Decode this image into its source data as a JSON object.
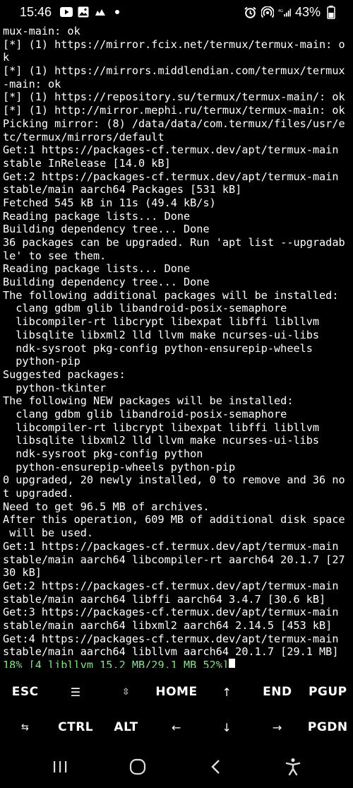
{
  "status_bar": {
    "time": "15:46",
    "battery": "43%",
    "left_icons": [
      "youtube-icon",
      "gallery-icon",
      "cloud-icon",
      "dot-icon"
    ],
    "right_icons": [
      "alarm-icon",
      "hotspot-icon",
      "signal-icon",
      "battery-icon"
    ]
  },
  "terminal": {
    "lines": [
      "mux-main: ok",
      "[*] (1) https://mirror.fcix.net/termux/termux-main: o",
      "k",
      "[*] (1) https://mirrors.middlendian.com/termux/termux",
      "-main: ok",
      "[*] (1) https://repository.su/termux/termux-main/: ok",
      "[*] (1) http://mirror.mephi.ru/termux/termux-main: ok",
      "Picking mirror: (8) /data/data/com.termux/files/usr/e",
      "tc/termux/mirrors/default",
      "Get:1 https://packages-cf.termux.dev/apt/termux-main",
      "stable InRelease [14.0 kB]",
      "Get:2 https://packages-cf.termux.dev/apt/termux-main",
      "stable/main aarch64 Packages [531 kB]",
      "Fetched 545 kB in 11s (49.4 kB/s)",
      "Reading package lists... Done",
      "Building dependency tree... Done",
      "36 packages can be upgraded. Run 'apt list --upgradab",
      "le' to see them.",
      "Reading package lists... Done",
      "Building dependency tree... Done",
      "The following additional packages will be installed:",
      "  clang gdbm glib libandroid-posix-semaphore",
      "  libcompiler-rt libcrypt libexpat libffi libllvm",
      "  libsqlite libxml2 lld llvm make ncurses-ui-libs",
      "  ndk-sysroot pkg-config python-ensurepip-wheels",
      "  python-pip",
      "Suggested packages:",
      "  python-tkinter",
      "The following NEW packages will be installed:",
      "  clang gdbm glib libandroid-posix-semaphore",
      "  libcompiler-rt libcrypt libexpat libffi libllvm",
      "  libsqlite libxml2 lld llvm make ncurses-ui-libs",
      "  ndk-sysroot pkg-config python",
      "  python-ensurepip-wheels python-pip",
      "0 upgraded, 20 newly installed, 0 to remove and 36 no",
      "t upgraded.",
      "Need to get 96.5 MB of archives.",
      "After this operation, 609 MB of additional disk space",
      " will be used.",
      "Get:1 https://packages-cf.termux.dev/apt/termux-main",
      "stable/main aarch64 libcompiler-rt aarch64 20.1.7 [27",
      "30 kB]",
      "Get:2 https://packages-cf.termux.dev/apt/termux-main",
      "stable/main aarch64 libffi aarch64 3.4.7 [30.6 kB]",
      "Get:3 https://packages-cf.termux.dev/apt/termux-main",
      "stable/main aarch64 libxml2 aarch64 2.14.5 [453 kB]",
      "Get:4 https://packages-cf.termux.dev/apt/termux-main",
      "stable/main aarch64 libllvm aarch64 20.1.7 [29.1 MB]"
    ],
    "progress_line": "18% [4 libllvm 15.2 MB/29.1 MB 52%]",
    "progress_color": "#8ee08e"
  },
  "extra_keys": {
    "row1": [
      "ESC",
      "☰",
      "⇳",
      "HOME",
      "↑",
      "END",
      "PGUP"
    ],
    "row2": [
      "⇆",
      "CTRL",
      "ALT",
      "←",
      "↓",
      "→",
      "PGDN"
    ]
  },
  "nav_bar": {
    "buttons": [
      "recents-icon",
      "home-icon",
      "back-icon",
      "accessibility-icon"
    ]
  }
}
